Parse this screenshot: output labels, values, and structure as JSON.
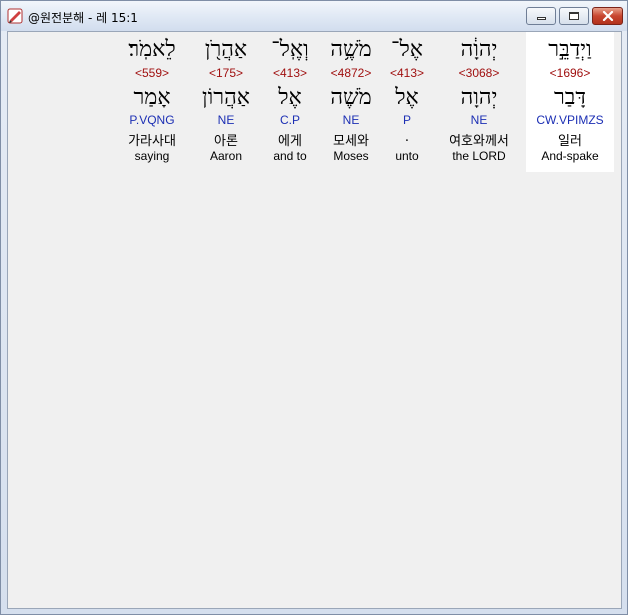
{
  "window": {
    "title": "@원전분해 - 레 15:1"
  },
  "words": [
    {
      "hebrew": "לֵאמֹֽר׃",
      "strong": "<559>",
      "lemma": "אָמַר",
      "morph": "P.VQNG",
      "korean": "가라사대",
      "english": "saying"
    },
    {
      "hebrew": "אַהֲרֹ֖ן",
      "strong": "<175>",
      "lemma": "אַהֲרוֹן",
      "morph": "NE",
      "korean": "아론",
      "english": "Aaron"
    },
    {
      "hebrew": "וְאֶֽל־",
      "strong": "<413>",
      "lemma": "אֶל",
      "morph": "C.P",
      "korean": "에게",
      "english": "and to"
    },
    {
      "hebrew": "מֹשֶׁ֥ה",
      "strong": "<4872>",
      "lemma": "מֹשֶׁה",
      "morph": "NE",
      "korean": "모세와",
      "english": "Moses"
    },
    {
      "hebrew": "אֶל־",
      "strong": "<413>",
      "lemma": "אֶל",
      "morph": "P",
      "korean": ".",
      "english": "unto"
    },
    {
      "hebrew": "יְהוָ֔ה",
      "strong": "<3068>",
      "lemma": "יְהוָה",
      "morph": "NE",
      "korean": "여호와께서",
      "english": "the LORD"
    },
    {
      "hebrew": "וַיְדַבֵּ֣ר",
      "strong": "<1696>",
      "lemma": "דָּבַר",
      "morph": "CW.VPIMZS",
      "korean": "일러",
      "english": "And-spake",
      "selected": true
    }
  ]
}
